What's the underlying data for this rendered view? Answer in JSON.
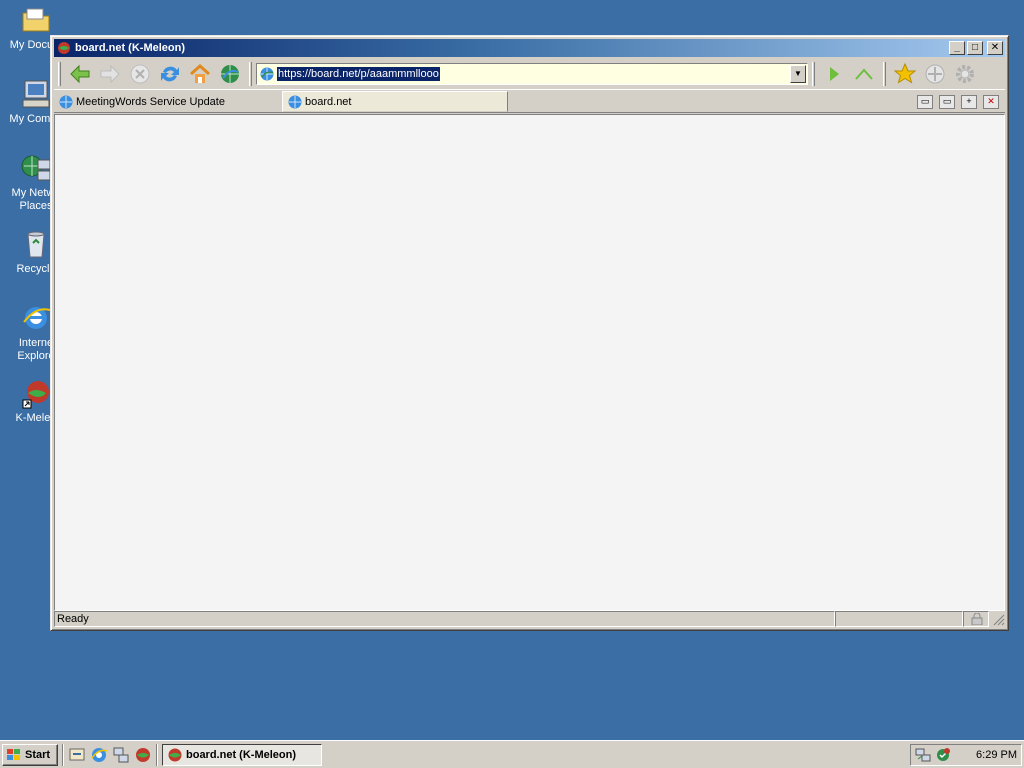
{
  "desktop": {
    "icons": [
      {
        "label": "My Documents",
        "shown": "My Docum"
      },
      {
        "label": "My Computer",
        "shown": "My Compu"
      },
      {
        "label_line1": "My Netwo",
        "label_line2": "Places"
      },
      {
        "label": "Recycle"
      },
      {
        "label_line1": "Interne",
        "label_line2": "Explore"
      },
      {
        "label": "K-Meleo"
      }
    ]
  },
  "window": {
    "title": "board.net (K-Meleon)",
    "controls": {
      "minimize": "_",
      "maximize": "□",
      "close": "✕"
    },
    "toolbar": {
      "url": "https://board.net/p/aaammmllooo",
      "icons": [
        "back-icon",
        "forward-icon",
        "stop-icon",
        "reload-icon",
        "home-icon",
        "browser-globe-icon",
        "go-icon",
        "up-icon",
        "bookmarks-star-icon",
        "navigate-icon",
        "settings-gear-icon"
      ]
    },
    "tabs": [
      {
        "label": "MeetingWords Service Update",
        "active": false
      },
      {
        "label": "board.net",
        "active": true
      }
    ],
    "status": {
      "text": "Ready"
    }
  },
  "taskbar": {
    "start_label": "Start",
    "task_label": "board.net (K-Meleon)",
    "clock": "6:29 PM"
  },
  "colors": {
    "desktop": "#3a6ea5",
    "title_active": "#0a246a",
    "selection": "#0a246a",
    "url_bg": "#ffffe1",
    "face": "#d4d0c8"
  }
}
